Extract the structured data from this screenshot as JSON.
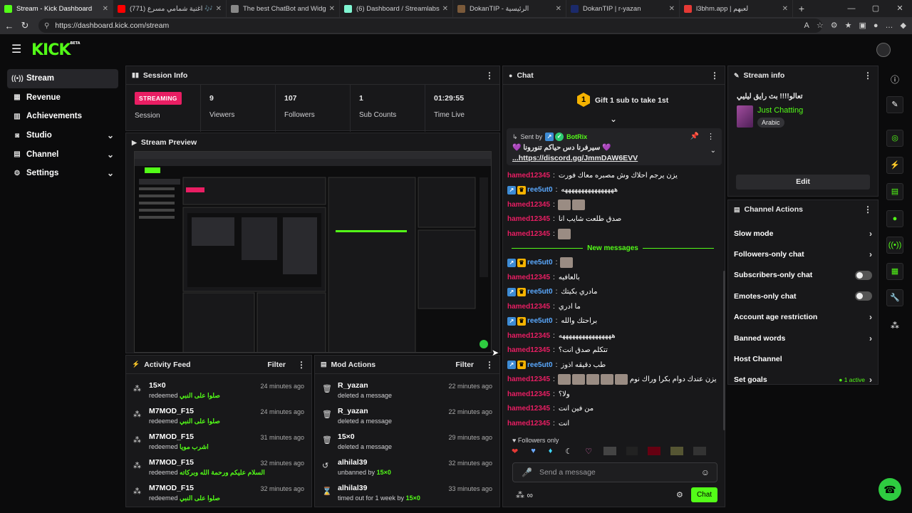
{
  "browser": {
    "tabs": [
      {
        "title": "Stream - Kick Dashboard",
        "color": "#53fc18",
        "active": true
      },
      {
        "title": "(771) اغنية شمامي مسرع 🎶",
        "color": "#ff0000",
        "active": false
      },
      {
        "title": "The best ChatBot and Widgets fo",
        "color": "#888888",
        "active": false
      },
      {
        "title": "(6) Dashboard / Streamlabs",
        "color": "#80f5d2",
        "active": false
      },
      {
        "title": "DokanTIP - الرئيسية",
        "color": "#7b5a3a",
        "active": false
      },
      {
        "title": "DokanTIP | r-yazan",
        "color": "#1b2a6b",
        "active": false
      },
      {
        "title": "l3bhm.app | لعبهم",
        "color": "#e53935",
        "active": false
      }
    ],
    "url": "https://dashboard.kick.com/stream"
  },
  "app": {
    "logo": "KICK",
    "logo_sup": "BETA"
  },
  "sidebar": {
    "items": [
      {
        "label": "Stream",
        "icon": "broadcast-icon",
        "glyph": "((•))",
        "active": true,
        "chev": false
      },
      {
        "label": "Revenue",
        "icon": "revenue-icon",
        "glyph": "▦",
        "active": false,
        "chev": false
      },
      {
        "label": "Achievements",
        "icon": "achievements-icon",
        "glyph": "▥",
        "active": false,
        "chev": false
      },
      {
        "label": "Studio",
        "icon": "studio-icon",
        "glyph": "◙",
        "active": false,
        "chev": true
      },
      {
        "label": "Channel",
        "icon": "channel-icon",
        "glyph": "▤",
        "active": false,
        "chev": true
      },
      {
        "label": "Settings",
        "icon": "settings-icon",
        "glyph": "⚙",
        "active": false,
        "chev": true
      }
    ]
  },
  "session": {
    "title": "Session Info",
    "badge": "STREAMING",
    "stats": [
      {
        "value": "",
        "label": "Session"
      },
      {
        "value": "9",
        "label": "Viewers"
      },
      {
        "value": "107",
        "label": "Followers"
      },
      {
        "value": "1",
        "label": "Sub Counts"
      },
      {
        "value": "01:29:55",
        "label": "Time Live"
      }
    ]
  },
  "preview": {
    "title": "Stream Preview"
  },
  "activity": {
    "title": "Activity Feed",
    "filter": "Filter",
    "rows": [
      {
        "user": "15×0",
        "action": "redeemed",
        "reward": "صلوا على النبي",
        "time": "24 minutes ago"
      },
      {
        "user": "M7MOD_F15",
        "action": "redeemed",
        "reward": "صلوا على النبي",
        "time": "24 minutes ago"
      },
      {
        "user": "M7MOD_F15",
        "action": "redeemed",
        "reward": "اشرب مويا",
        "time": "31 minutes ago"
      },
      {
        "user": "M7MOD_F15",
        "action": "redeemed",
        "reward": "السلام عليكم ورحمة الله وبركاته",
        "time": "32 minutes ago"
      },
      {
        "user": "M7MOD_F15",
        "action": "redeemed",
        "reward": "صلوا على النبي",
        "time": "32 minutes ago"
      }
    ]
  },
  "mod": {
    "title": "Mod Actions",
    "filter": "Filter",
    "rows": [
      {
        "user": "R_yazan",
        "action": "deleted a message",
        "by": "",
        "time": "22 minutes ago",
        "icon": "trash-icon",
        "glyph": "🗑"
      },
      {
        "user": "R_yazan",
        "action": "deleted a message",
        "by": "",
        "time": "22 minutes ago",
        "icon": "trash-icon",
        "glyph": "🗑"
      },
      {
        "user": "15×0",
        "action": "deleted a message",
        "by": "",
        "time": "29 minutes ago",
        "icon": "trash-icon",
        "glyph": "🗑"
      },
      {
        "user": "alhilal39",
        "action": "unbanned by",
        "by": "15×0",
        "time": "32 minutes ago",
        "icon": "unban-icon",
        "glyph": "↺"
      },
      {
        "user": "alhilal39",
        "action": "timed out for 1 week by",
        "by": "15×0",
        "time": "33 minutes ago",
        "icon": "hourglass-icon",
        "glyph": "⌛"
      }
    ]
  },
  "chat": {
    "title": "Chat",
    "gift_text": "Gift 1 sub to take 1st",
    "gift_rank": "1",
    "pinned": {
      "sent_by": "Sent by",
      "bot": "BotRix",
      "message": "💜 سيرفرنا دس حياكم تنورونا 💜",
      "link": "...https://discord.gg/JmmDAW6EVV"
    },
    "new_messages": "New messages",
    "messages": [
      {
        "user": "hamed12345",
        "text": "يزن يرجم احلاك وش مصبره معاك فورت",
        "color": "red",
        "badges": false,
        "emotes": 0
      },
      {
        "user": "ree5ut0",
        "text": "ههههههههههههههههه",
        "color": "blue",
        "badges": true,
        "emotes": 0
      },
      {
        "user": "hamed12345",
        "text": "",
        "color": "red",
        "badges": false,
        "emotes": 2
      },
      {
        "user": "hamed12345",
        "text": "صدق طلعت شايب انا",
        "color": "red",
        "badges": false,
        "emotes": 0
      },
      {
        "user": "hamed12345",
        "text": "",
        "color": "red",
        "badges": false,
        "emotes": 1
      }
    ],
    "messages2": [
      {
        "user": "ree5ut0",
        "text": "",
        "color": "blue",
        "badges": true,
        "emotes": 1
      },
      {
        "user": "hamed12345",
        "text": "بالعافيه",
        "color": "red",
        "badges": false,
        "emotes": 0
      },
      {
        "user": "ree5ut0",
        "text": "مادري بكيتك",
        "color": "blue",
        "badges": true,
        "emotes": 0
      },
      {
        "user": "hamed12345",
        "text": "ما ادري",
        "color": "red",
        "badges": false,
        "emotes": 0
      },
      {
        "user": "ree5ut0",
        "text": "براحتك والله",
        "color": "blue",
        "badges": true,
        "emotes": 0
      },
      {
        "user": "hamed12345",
        "text": "ههههههههههههههههه",
        "color": "red",
        "badges": false,
        "emotes": 0
      },
      {
        "user": "hamed12345",
        "text": "تتكلم صدق انت؟",
        "color": "red",
        "badges": false,
        "emotes": 0
      },
      {
        "user": "ree5ut0",
        "text": "طب دقيقه اذوز",
        "color": "blue",
        "badges": true,
        "emotes": 0
      },
      {
        "user": "hamed12345",
        "text": "يزن عندك دوام بكرا وراك نوم",
        "color": "red",
        "badges": false,
        "emotes": 5
      },
      {
        "user": "hamed12345",
        "text": "ولا؟",
        "color": "red",
        "badges": false,
        "emotes": 0
      },
      {
        "user": "hamed12345",
        "text": "من فين انت",
        "color": "red",
        "badges": false,
        "emotes": 0
      },
      {
        "user": "hamed12345",
        "text": "انت",
        "color": "red",
        "badges": false,
        "emotes": 0
      }
    ],
    "followers_only": "Followers only",
    "placeholder": "Send a message",
    "send": "Chat"
  },
  "stream_info": {
    "title": "Stream info",
    "stream_title": "تعالو!!!! بث رايق ليليي",
    "category": "Just Chatting",
    "tag": "Arabic",
    "edit": "Edit"
  },
  "channel_actions": {
    "title": "Channel Actions",
    "rows": [
      {
        "label": "Slow mode",
        "control": "chevron"
      },
      {
        "label": "Followers-only chat",
        "control": "chevron"
      },
      {
        "label": "Subscribers-only chat",
        "control": "toggle"
      },
      {
        "label": "Emotes-only chat",
        "control": "toggle"
      },
      {
        "label": "Account age restriction",
        "control": "chevron"
      },
      {
        "label": "Banned words",
        "control": "chevron"
      },
      {
        "label": "Host Channel",
        "control": "none"
      },
      {
        "label": "Set goals",
        "control": "chevron",
        "status": "1 active"
      }
    ]
  },
  "colors": {
    "accent": "#53fc18",
    "live": "#e91e63",
    "panel": "#18181a"
  }
}
